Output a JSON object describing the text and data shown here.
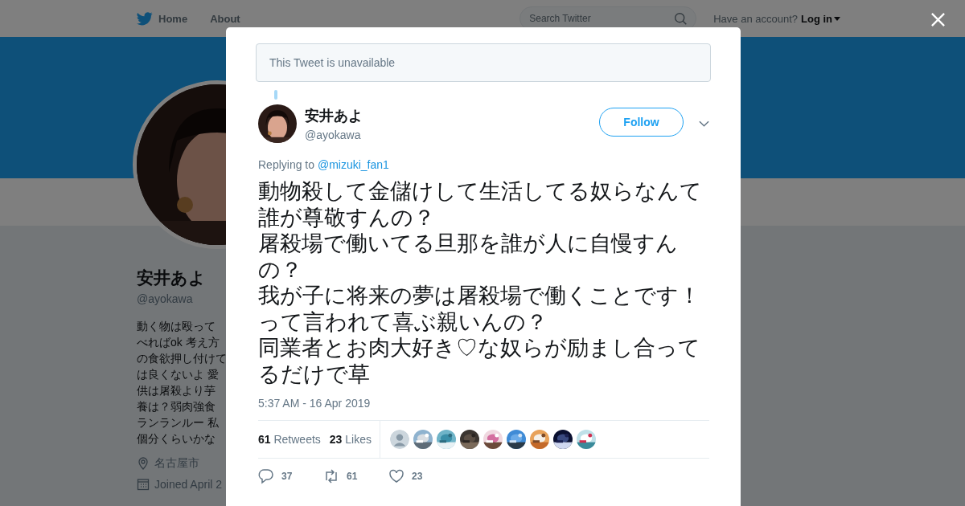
{
  "nav": {
    "home": "Home",
    "about": "About",
    "search_placeholder": "Search Twitter",
    "account_prompt": "Have an account?",
    "login": "Log in"
  },
  "profile": {
    "name": "安井あよ",
    "handle": "@ayokawa",
    "bio_lines": [
      "動く物は殴って",
      "べればok 考え方",
      "の食欲押し付けて",
      "は良くないよ 愛",
      "供は屠殺より芋",
      "養は？弱肉強食",
      "ランランルー 私",
      "個分くらいかな"
    ],
    "location": "名古屋市",
    "joined": "Joined April 2"
  },
  "modal": {
    "notice": "This Tweet is unavailable",
    "author": {
      "name": "安井あよ",
      "handle": "@ayokawa"
    },
    "follow": "Follow",
    "replying_prefix": "Replying to",
    "replying_to": "@mizuki_fan1",
    "text_paragraphs": [
      "動物殺して金儲けして生活してる奴らなんて誰が尊敬すんの？",
      "屠殺場で働いてる旦那を誰が人に自慢すんの？",
      "我が子に将来の夢は屠殺場で働くことです！って言われて喜ぶ親いんの？",
      "同業者とお肉大好き♡な奴らが励まし合ってるだけで草"
    ],
    "timestamp": "5:37 AM - 16 Apr 2019",
    "stats": [
      {
        "count": "61",
        "label": "Retweets"
      },
      {
        "count": "23",
        "label": "Likes"
      }
    ],
    "liker_avatars": [
      {
        "kind": "default"
      },
      {
        "kind": "picture"
      },
      {
        "kind": "picture"
      },
      {
        "kind": "picture"
      },
      {
        "kind": "picture"
      },
      {
        "kind": "picture"
      },
      {
        "kind": "picture"
      },
      {
        "kind": "picture"
      },
      {
        "kind": "picture"
      }
    ],
    "actions": [
      {
        "kind": "reply",
        "count": "37"
      },
      {
        "kind": "retweet",
        "count": "61"
      },
      {
        "kind": "like",
        "count": "23"
      }
    ]
  }
}
